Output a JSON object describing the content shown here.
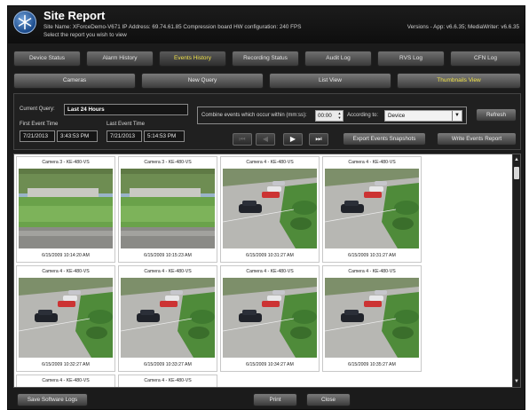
{
  "header": {
    "title": "Site Report",
    "site_info": "Site Name: XForceDemo-V671   IP Address: 69.74.61.85   Compression board HW configuration: 240 FPS",
    "versions": "Versions - App: v6.6.35; MediaWriter: v6.6.35",
    "hint": "Select the report you wish to view"
  },
  "tabs": [
    {
      "label": "Device Status",
      "active": false
    },
    {
      "label": "Alarm History",
      "active": false
    },
    {
      "label": "Events History",
      "active": true
    },
    {
      "label": "Recording Status",
      "active": false
    },
    {
      "label": "Audit Log",
      "active": false
    },
    {
      "label": "RVS Log",
      "active": false
    },
    {
      "label": "CFN Log",
      "active": false
    }
  ],
  "subbar": {
    "cameras": "Cameras",
    "new_query": "New Query",
    "list_view": "List View",
    "thumbnails_view": "Thumbnails View"
  },
  "query": {
    "current_query_label": "Current Query:",
    "current_query_value": "Last 24 Hours",
    "first_event_label": "First Event Time",
    "first_event_date": "7/21/2013",
    "first_event_time": "3:43:53 PM",
    "last_event_label": "Last Event Time",
    "last_event_date": "7/21/2013",
    "last_event_time": "5:14:53 PM",
    "combine_label": "Combine events which occur within (mm:ss):",
    "combine_value": "00:00",
    "according_label": "According to:",
    "according_value": "Device",
    "refresh": "Refresh",
    "export": "Export Events Snapshots",
    "write_report": "Write Events Report"
  },
  "thumbnails": [
    {
      "camera": "Camera 3 - KE-480-VS",
      "timestamp": "6/15/2009 10:14:20 AM",
      "scene": "lawn"
    },
    {
      "camera": "Camera 3 - KE-480-VS",
      "timestamp": "6/15/2009 10:15:23 AM",
      "scene": "lawn"
    },
    {
      "camera": "Camera 4 - KE-480-VS",
      "timestamp": "6/15/2009 10:31:27 AM",
      "scene": "parking"
    },
    {
      "camera": "Camera 4 - KE-480-VS",
      "timestamp": "6/15/2009 10:31:27 AM",
      "scene": "parking"
    },
    {
      "camera": "Camera 4 - KE-480-VS",
      "timestamp": "6/15/2009 10:32:27 AM",
      "scene": "parking"
    },
    {
      "camera": "Camera 4 - KE-480-VS",
      "timestamp": "6/15/2009 10:33:27 AM",
      "scene": "parking"
    },
    {
      "camera": "Camera 4 - KE-480-VS",
      "timestamp": "6/15/2009 10:34:27 AM",
      "scene": "parking"
    },
    {
      "camera": "Camera 4 - KE-480-VS",
      "timestamp": "6/15/2009 10:35:27 AM",
      "scene": "parking"
    },
    {
      "camera": "Camera 4 - KE-480-VS",
      "timestamp": "",
      "scene": ""
    },
    {
      "camera": "Camera 4 - KE-480-VS",
      "timestamp": "",
      "scene": ""
    }
  ],
  "bottom": {
    "save_logs": "Save Software Logs",
    "print": "Print",
    "close": "Close"
  },
  "colors": {
    "active_tab_text": "#f0e24a",
    "background": "#1b1b1b"
  }
}
